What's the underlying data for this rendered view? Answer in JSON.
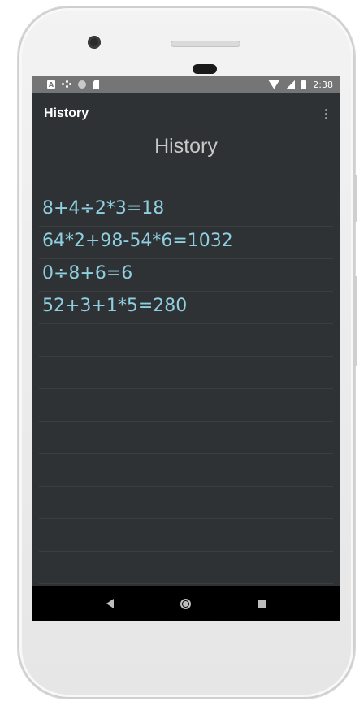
{
  "status_bar": {
    "time": "2:38",
    "left_icons": [
      "a-notification-icon",
      "assistant-dots-icon",
      "circle-icon",
      "sd-card-icon"
    ],
    "right_icons": [
      "wifi-icon",
      "signal-icon",
      "battery-icon"
    ]
  },
  "toolbar": {
    "title": "History",
    "menu_icon": "overflow-menu-icon"
  },
  "main": {
    "heading": "History",
    "history_items": [
      {
        "expression": "8+4÷2*3=18"
      },
      {
        "expression": "64*2+98-54*6=1032"
      },
      {
        "expression": "0÷8+6=6"
      },
      {
        "expression": "52+3+1*5=280"
      },
      {
        "expression": ""
      },
      {
        "expression": ""
      },
      {
        "expression": ""
      },
      {
        "expression": ""
      },
      {
        "expression": ""
      },
      {
        "expression": ""
      },
      {
        "expression": ""
      },
      {
        "expression": ""
      },
      {
        "expression": ""
      }
    ]
  },
  "nav_bar": {
    "icons": [
      "back-icon",
      "home-icon",
      "recents-icon"
    ]
  },
  "colors": {
    "screen_background": "#2f3234",
    "status_bar": "#757575",
    "history_text": "#8ecfe0",
    "heading_text": "#c8c8c8",
    "nav_bar": "#000000"
  }
}
